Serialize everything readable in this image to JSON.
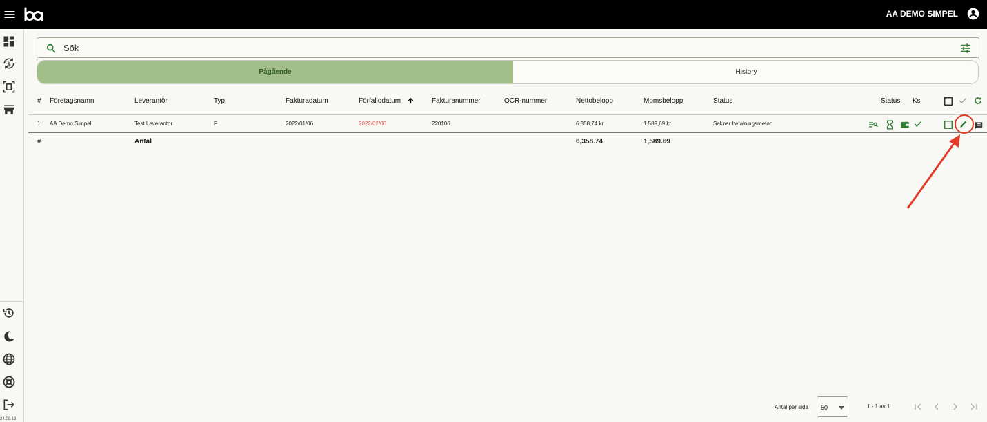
{
  "topbar": {
    "user_name": "AA DEMO SIMPEL",
    "icons": [
      "menu-icon",
      "logo",
      "account-circle-icon"
    ]
  },
  "sidebar": {
    "top_icons": [
      "dashboard-icon",
      "currency-exchange-icon",
      "document-scan-icon",
      "store-icon"
    ],
    "bottom_icons": [
      "history-icon",
      "dark-mode-icon",
      "globe-icon",
      "lifebuoy-icon",
      "logout-icon"
    ],
    "version": "24.09.13"
  },
  "search": {
    "placeholder": "Sök"
  },
  "tabs": [
    {
      "label": "Pågående",
      "active": true
    },
    {
      "label": "History",
      "active": false
    }
  ],
  "table": {
    "headers": {
      "num": "#",
      "company": "Företagsnamn",
      "supplier": "Leverantör",
      "type": "Typ",
      "invoice_date": "Fakturadatum",
      "due_date": "Förfallodatum",
      "invoice_number": "Fakturanummer",
      "ocr": "OCR-nummer",
      "net": "Nettobelopp",
      "vat": "Momsbelopp",
      "status": "Status",
      "status2": "Status",
      "ks": "Ks"
    },
    "rows": [
      {
        "num": "1",
        "company": "AA Demo Simpel",
        "supplier": "Test Leverantor",
        "type": "F",
        "invoice_date": "2022/01/06",
        "due_date": "2022/02/06",
        "invoice_number": "220106",
        "ocr": "",
        "net": "6 358,74 kr",
        "vat": "1 589,69 kr",
        "status": "Saknar betalningsmetod"
      }
    ],
    "totals": {
      "num": "#",
      "label": "Antal",
      "net": "6,358.74",
      "vat": "1,589.69"
    }
  },
  "pagination": {
    "per_page_label": "Antal per sida",
    "per_page_value": "50",
    "range": "1 - 1 av 1"
  },
  "colors": {
    "accent_green": "#2e7d32",
    "tab_active": "#a2bf8a",
    "overdue_red": "#d9534f",
    "annotation_red": "#e43b2b"
  }
}
